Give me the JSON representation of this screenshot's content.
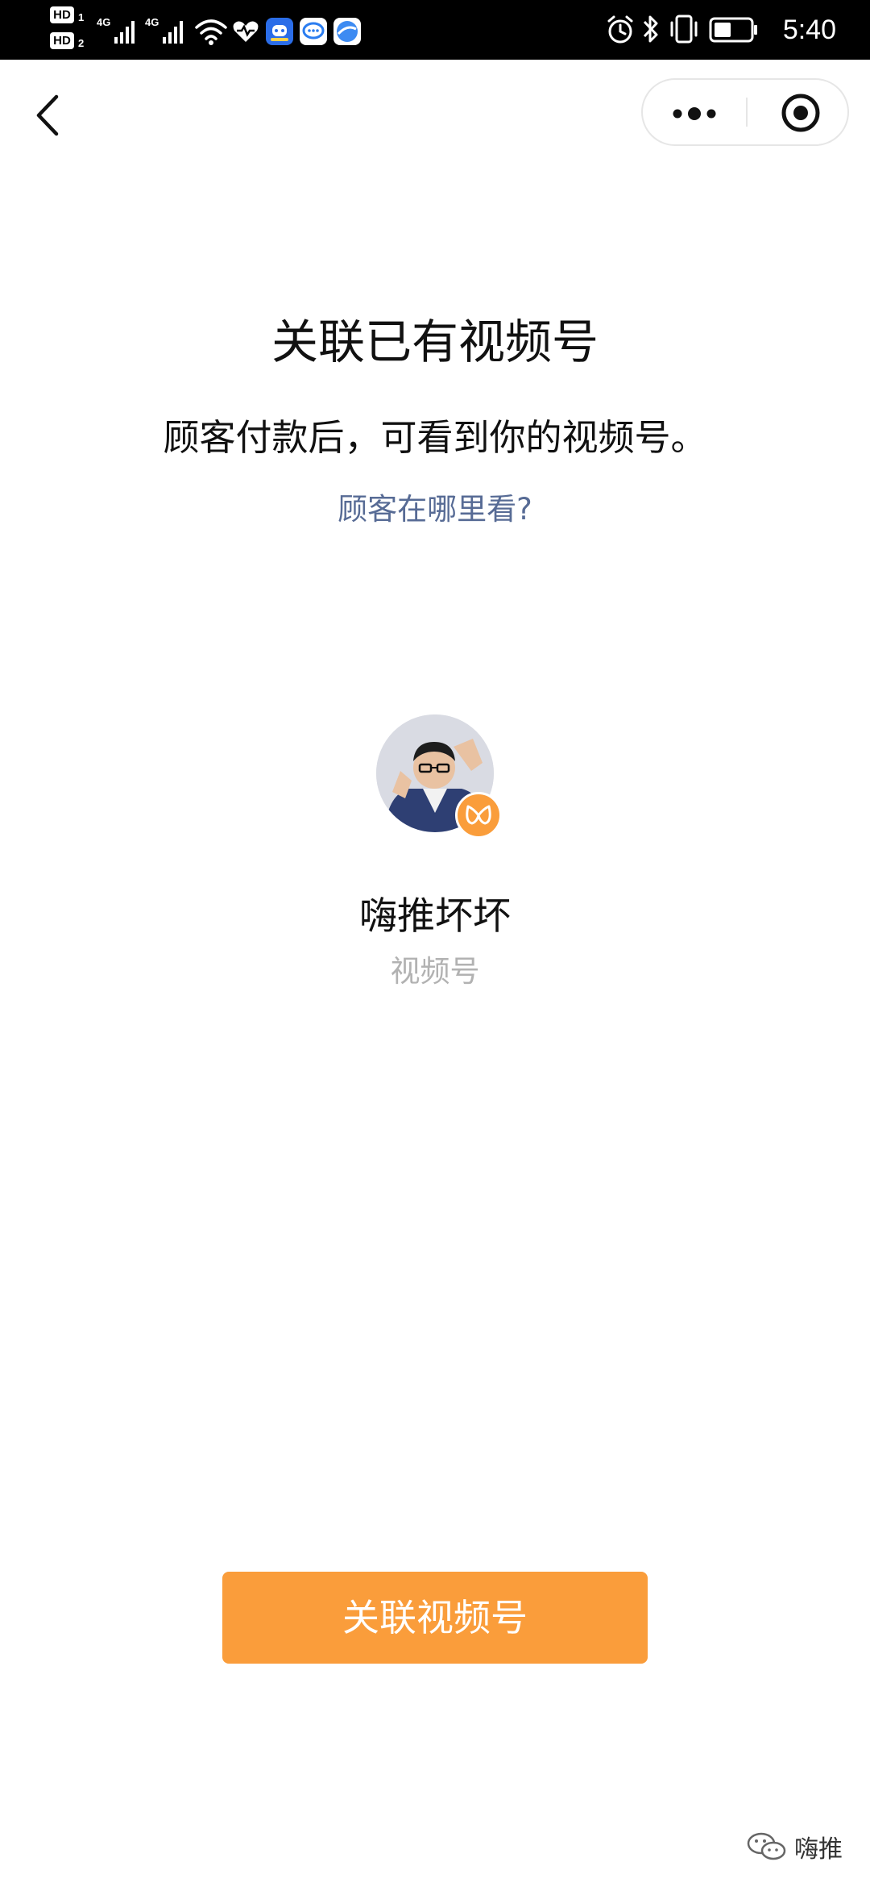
{
  "status_bar": {
    "hd1_label": "HD",
    "hd1_num": "1",
    "hd2_label": "HD",
    "hd2_num": "2",
    "network1": "4G",
    "network2": "4G",
    "time": "5:40",
    "icons": [
      "wifi-icon",
      "health-icon",
      "app-icon-1",
      "chat-icon",
      "browser-icon",
      "alarm-icon",
      "bluetooth-icon",
      "vibrate-icon",
      "battery-icon"
    ]
  },
  "nav": {
    "back_icon": "chevron-left-icon",
    "more_icon": "more-dots-icon",
    "close_icon": "target-close-icon"
  },
  "main": {
    "title": "关联已有视频号",
    "subtitle": "顾客付款后，可看到你的视频号。",
    "help_link": "顾客在哪里看?",
    "account": {
      "name": "嗨推坏坏",
      "type": "视频号",
      "badge_icon": "channels-butterfly-icon"
    },
    "primary_button": "关联视频号"
  },
  "watermark": {
    "icon": "wechat-icon",
    "text": "嗨推"
  },
  "colors": {
    "accent": "#fa9d3b",
    "link": "#576b95",
    "muted": "#b2b2b2",
    "status_bar": "#000000"
  }
}
